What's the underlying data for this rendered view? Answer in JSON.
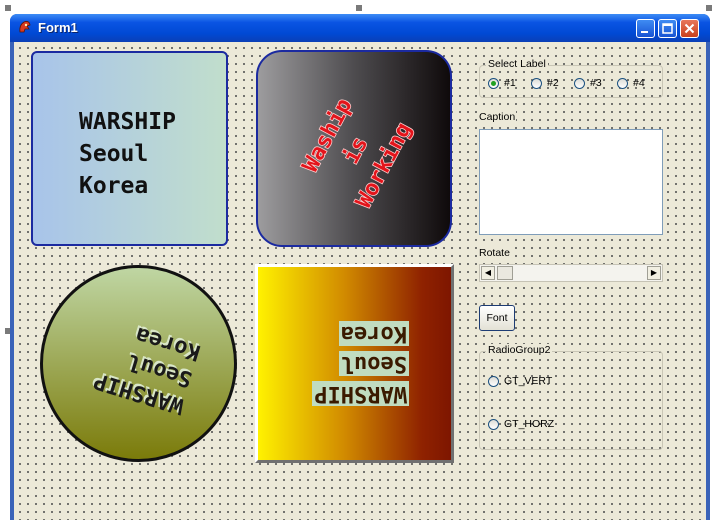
{
  "window": {
    "title": "Form1"
  },
  "panel_square": {
    "lines": [
      "WARSHIP",
      "Seoul",
      "Korea"
    ]
  },
  "panel_rounded": {
    "lines": [
      "Waship",
      "is",
      "Working"
    ]
  },
  "panel_circle": {
    "lines": [
      "WARSHIP",
      "Seoul",
      "Korea"
    ]
  },
  "panel_bevel": {
    "lines": [
      "WARSHIP",
      "Seoul",
      "Korea"
    ]
  },
  "select_label": {
    "title": "Select Label",
    "options": [
      "#1",
      "#2",
      "#3",
      "#4"
    ],
    "selected": "#1"
  },
  "caption": {
    "label": "Caption",
    "value": ""
  },
  "rotate": {
    "label": "Rotate",
    "value_fraction": 0.0
  },
  "font_button": {
    "label": "Font"
  },
  "radio_group2": {
    "title": "RadioGroup2",
    "options": [
      "GT_VERT",
      "GT_HORZ"
    ]
  },
  "colors": {
    "title_bar": "#0a54e3",
    "form_bg": "#ece9d8",
    "text_red": "#e3141b"
  }
}
